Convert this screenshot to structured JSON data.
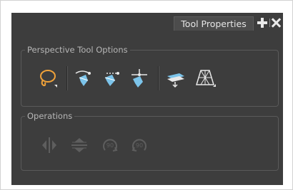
{
  "panel": {
    "tab_label": "Tool Properties"
  },
  "perspective_group": {
    "title": "Perspective Tool Options",
    "tools": [
      "lasso-select-icon",
      "perspective-left-icon",
      "perspective-right-icon",
      "perspective-both-icon",
      "flatten-plane-icon",
      "perspective-grid-icon"
    ]
  },
  "operations_group": {
    "title": "Operations",
    "tools": [
      "flip-horizontal-icon",
      "flip-vertical-icon",
      "rotate-90-cw-icon",
      "rotate-90-ccw-icon"
    ]
  },
  "colors": {
    "panel_bg": "#3d3d3d",
    "accent_orange": "#f0a23a",
    "icon_blue": "#7cc4ea",
    "disabled_icon": "#5e5e5e"
  }
}
